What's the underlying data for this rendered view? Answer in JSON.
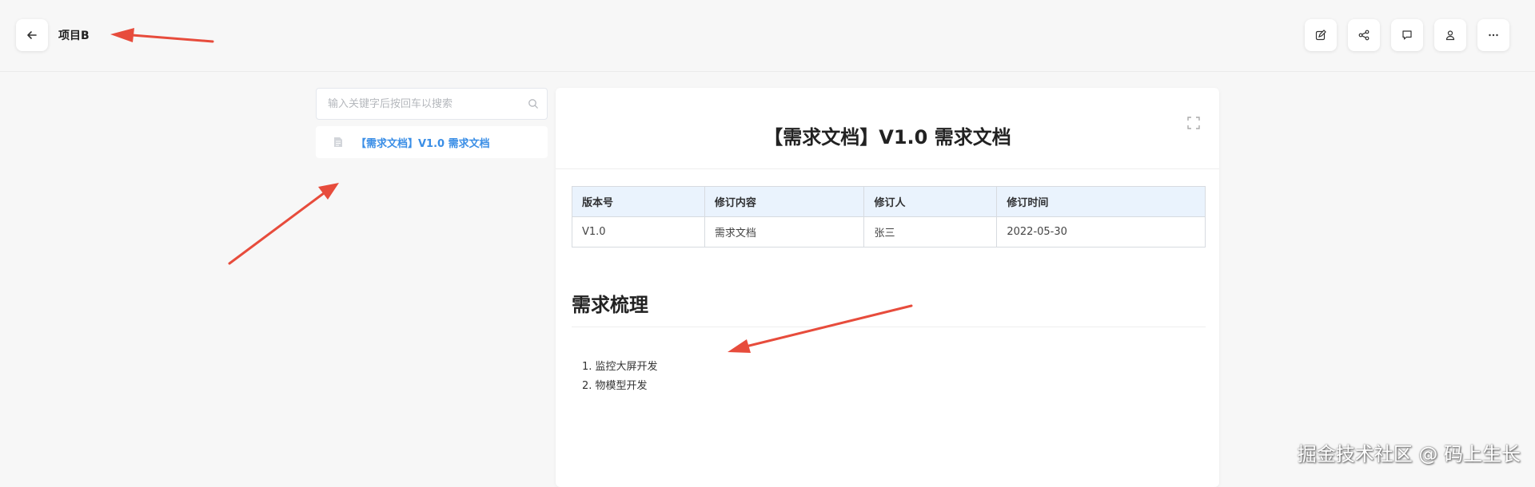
{
  "topbar": {
    "project_title": "项目B",
    "back_icon": "arrow-left-icon",
    "actions": [
      {
        "icon": "edit-icon"
      },
      {
        "icon": "share-icon"
      },
      {
        "icon": "comment-icon"
      },
      {
        "icon": "user-icon"
      },
      {
        "icon": "more-icon"
      }
    ]
  },
  "sidebar": {
    "search_placeholder": "输入关键字后按回车以搜索",
    "search_value": "",
    "items": [
      {
        "label": "【需求文档】V1.0 需求文档",
        "icon": "document-icon"
      }
    ]
  },
  "document": {
    "title": "【需求文档】V1.0 需求文档",
    "revision_table": {
      "headers": [
        "版本号",
        "修订内容",
        "修订人",
        "修订时间"
      ],
      "rows": [
        [
          "V1.0",
          "需求文档",
          "张三",
          "2022-05-30"
        ]
      ]
    },
    "section_heading": "需求梳理",
    "list": [
      "1. 监控大屏开发",
      "2. 物模型开发"
    ]
  },
  "watermark": "掘金技术社区 @ 码上生长",
  "colors": {
    "accent": "#3a8ee6",
    "annotation_arrow": "#e74c3c",
    "table_header_bg": "#eaf3fd"
  }
}
